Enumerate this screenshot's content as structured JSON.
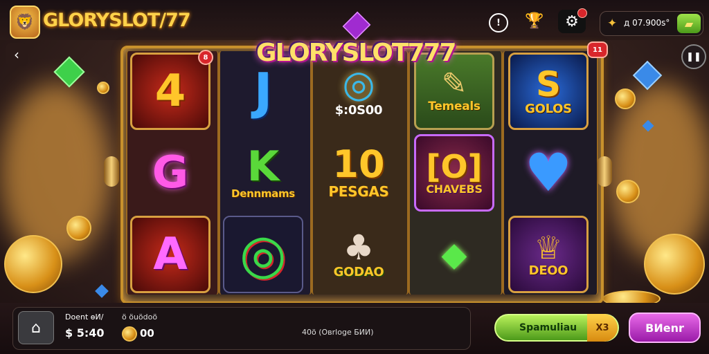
{
  "header": {
    "brand": "GLORYSLOT/77",
    "wallet_amount": "д 07.900s°",
    "icons": [
      "info-icon",
      "trophy-icon",
      "settings-gear-icon",
      "coin-icon",
      "cash-add-icon"
    ]
  },
  "game": {
    "logo_text": "GLORYSLOT777",
    "badges": {
      "left": "8",
      "right": "11"
    },
    "reels": [
      [
        {
          "glyph": "4",
          "caption": ""
        },
        {
          "glyph": "G",
          "caption": ""
        },
        {
          "glyph": "A",
          "caption": ""
        }
      ],
      [
        {
          "glyph": "J",
          "caption": ""
        },
        {
          "glyph": "K",
          "caption": "Dennmams"
        },
        {
          "glyph": "◎",
          "caption": ""
        }
      ],
      [
        {
          "glyph": "◎",
          "caption": "$:0S00"
        },
        {
          "glyph": "10",
          "caption": "PESGAS"
        },
        {
          "glyph": "♣",
          "caption": "GODAO"
        }
      ],
      [
        {
          "glyph": "✎",
          "caption": "Temeals"
        },
        {
          "glyph": "[O]",
          "caption": "CHAVEBS"
        },
        {
          "glyph": "◆",
          "caption": ""
        }
      ],
      [
        {
          "glyph": "S",
          "caption": "GOLOS"
        },
        {
          "glyph": "♥",
          "caption": ""
        },
        {
          "glyph": "♕",
          "caption": "DEOO"
        }
      ]
    ]
  },
  "footer": {
    "balance_label": "Doent өИ/",
    "balance_value": "$ 5:40",
    "bonus_label": "ö öuödoö",
    "bonus_value": "00",
    "center_text": "40ö (Oвrlоgе БИИ)",
    "spin_label": "Spamuliau",
    "spin_multiplier": "X3",
    "bet_label": "BИenr"
  },
  "colors": {
    "accent_gold": "#ffd24a",
    "spin_green": "#6cc32a",
    "bet_magenta": "#c23ac8",
    "badge_red": "#d8262b"
  }
}
